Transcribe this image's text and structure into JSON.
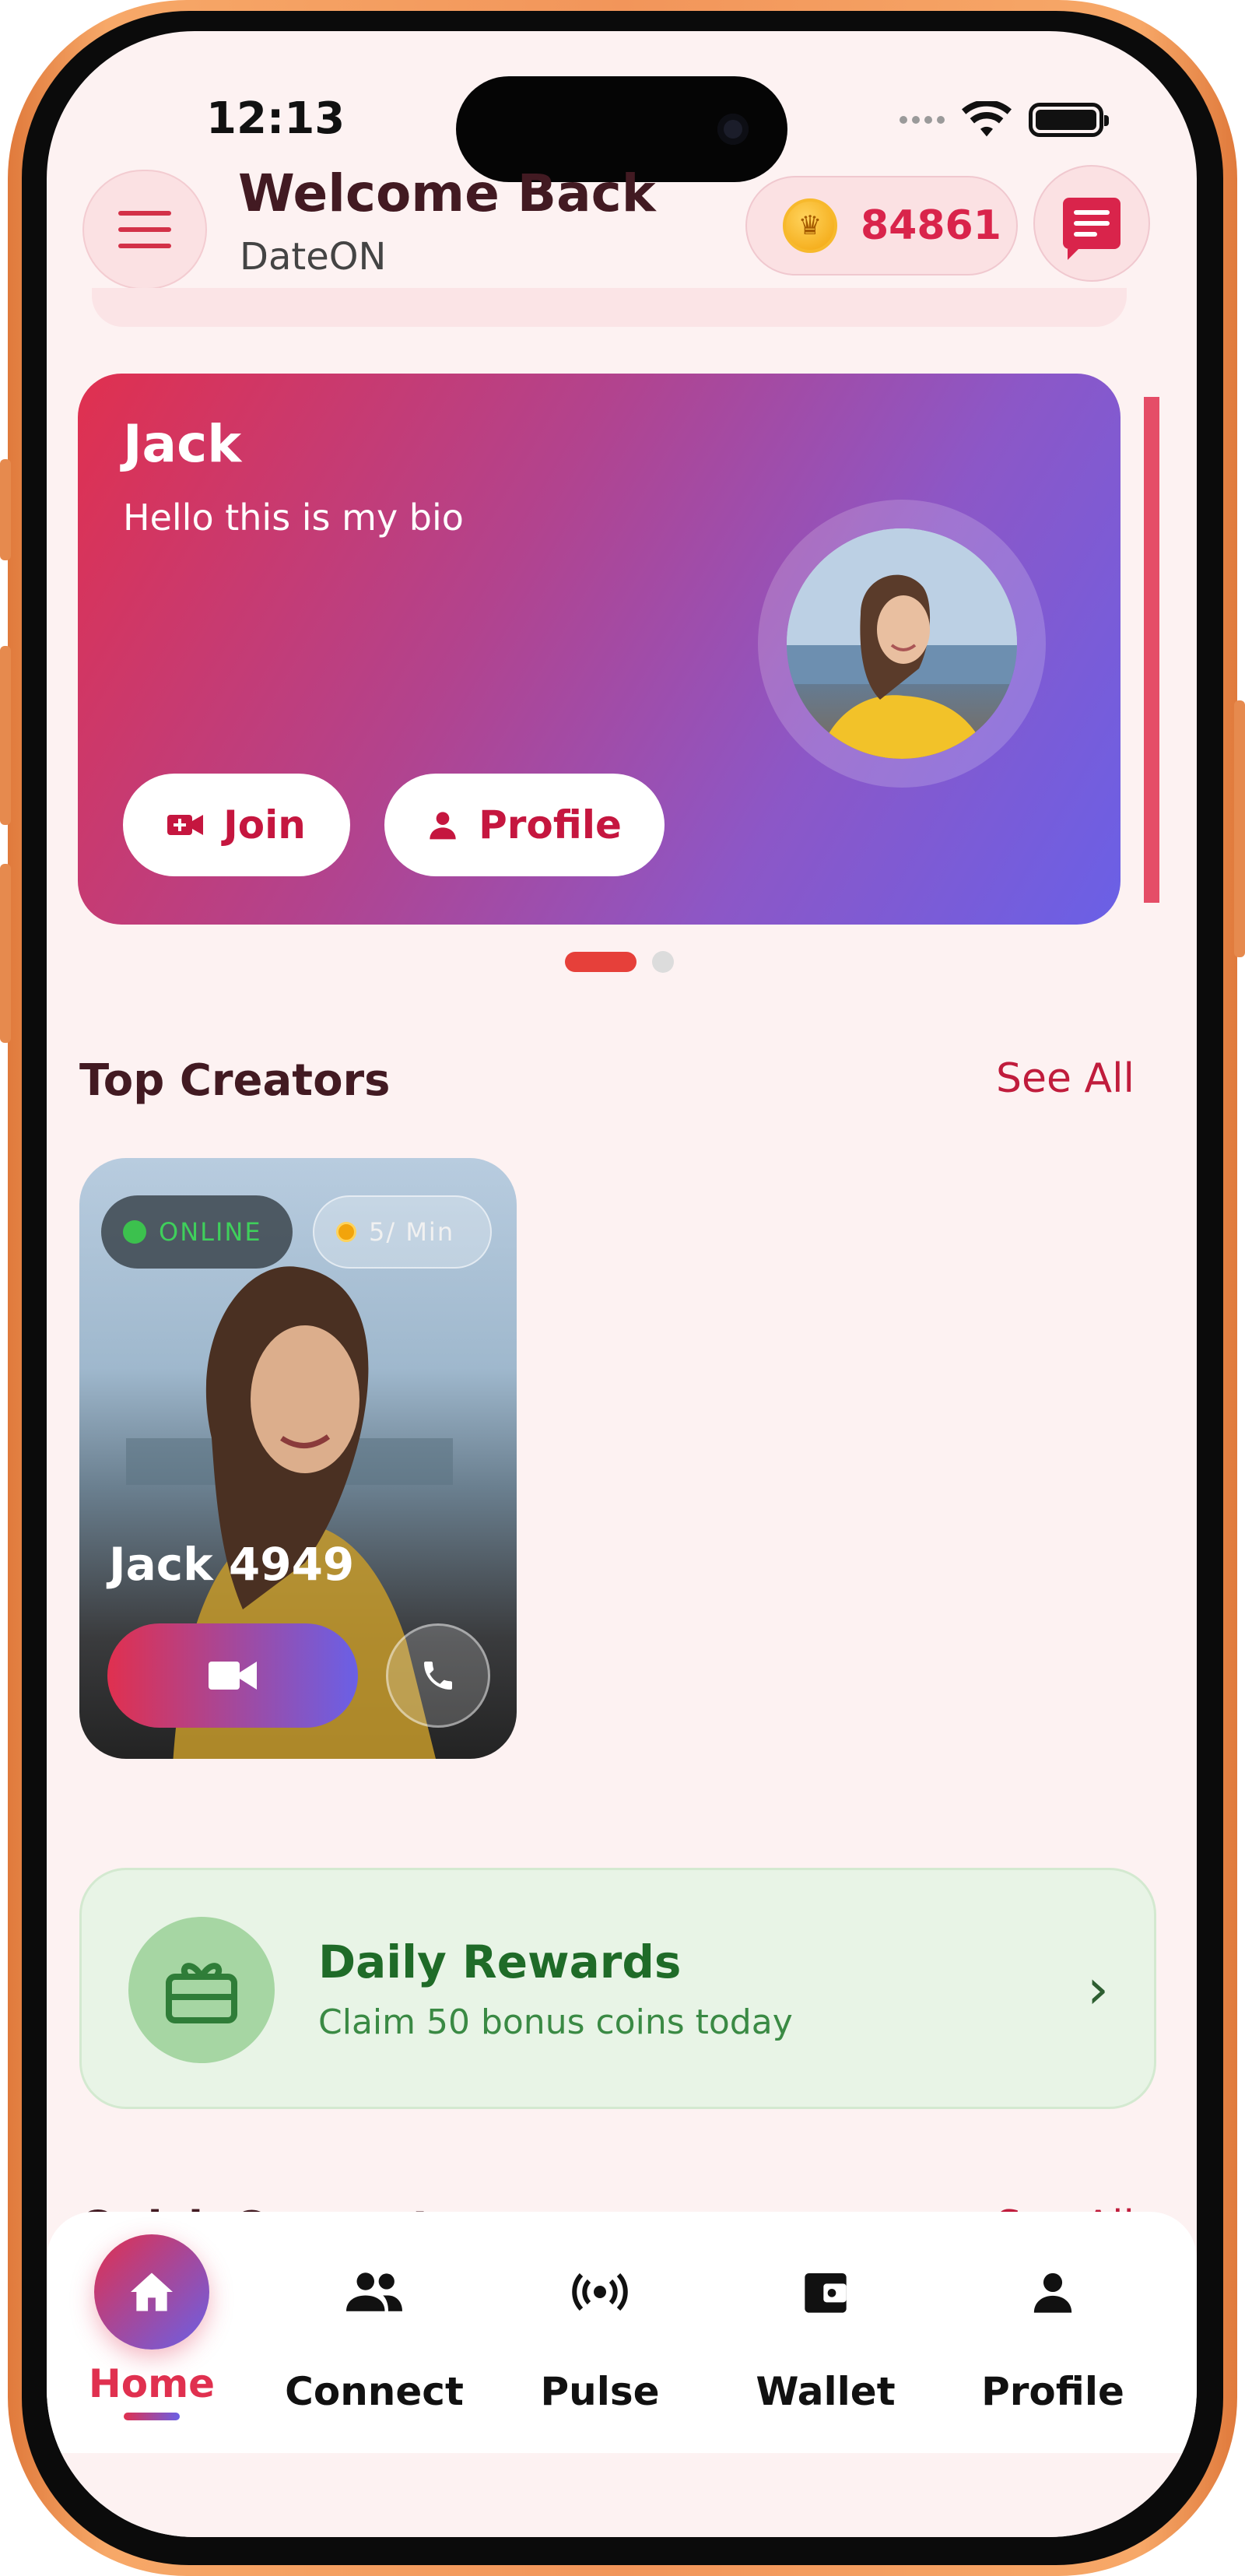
{
  "status_bar": {
    "time": "12:13"
  },
  "header": {
    "title": "Welcome Back",
    "app_name": "DateON",
    "coins": "84861",
    "menu_icon": "hamburger-menu-icon",
    "chat_icon": "chat-icon"
  },
  "hero_card": {
    "name": "Jack",
    "bio": "Hello this is my bio",
    "join_label": "Join",
    "profile_label": "Profile",
    "page_count": 2,
    "active_page": 1
  },
  "top_creators": {
    "title": "Top Creators",
    "see_all": "See All",
    "items": [
      {
        "status": "ONLINE",
        "rate": "5/ Min",
        "name": "Jack 4949"
      }
    ]
  },
  "daily_rewards": {
    "title": "Daily Rewards",
    "subtitle": "Claim 50 bonus coins today"
  },
  "quick_connect": {
    "title": "Quick Connect",
    "see_all": "See All"
  },
  "bottom_nav": {
    "items": [
      {
        "label": "Home",
        "icon": "home-icon",
        "active": true
      },
      {
        "label": "Connect",
        "icon": "people-icon",
        "active": false
      },
      {
        "label": "Pulse",
        "icon": "broadcast-icon",
        "active": false
      },
      {
        "label": "Wallet",
        "icon": "wallet-icon",
        "active": false
      },
      {
        "label": "Profile",
        "icon": "person-icon",
        "active": false
      }
    ]
  },
  "colors": {
    "accent": "#e0304f",
    "accent_secondary": "#6a60e6",
    "background": "#fdf2f2",
    "rewards_green": "#1f6b28",
    "online_green": "#3cc14e"
  }
}
